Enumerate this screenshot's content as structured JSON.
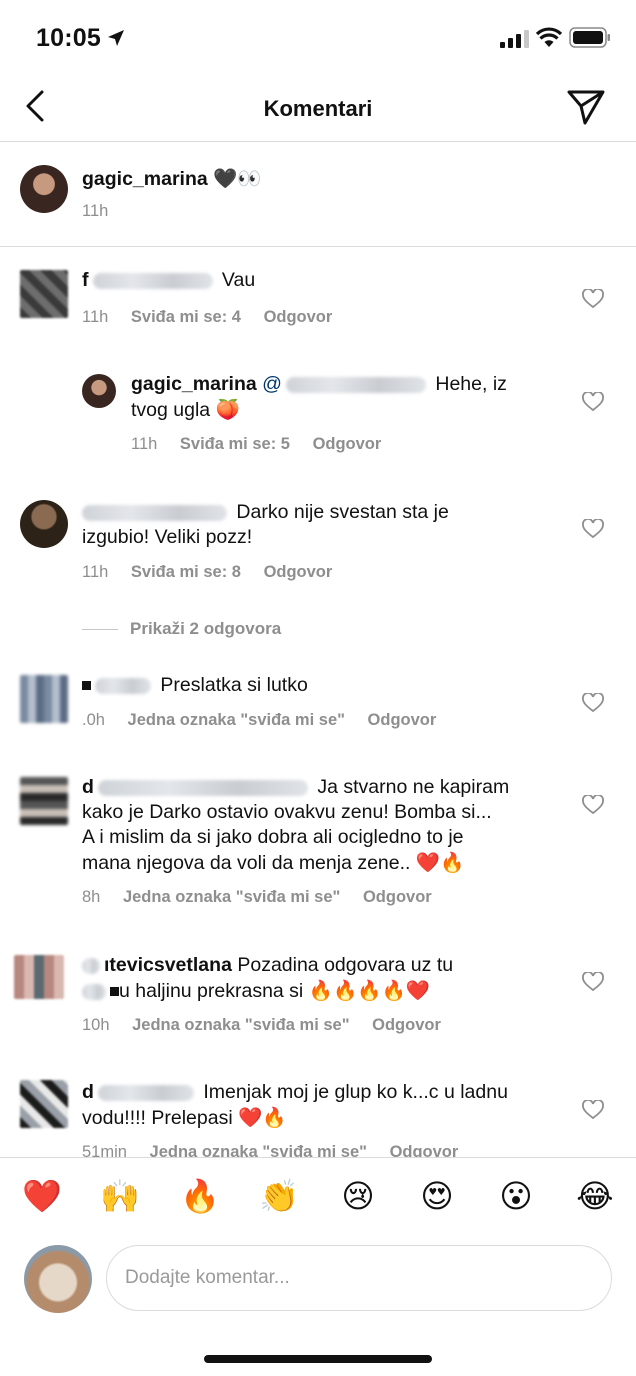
{
  "status_bar": {
    "time": "10:05"
  },
  "nav": {
    "title": "Komentari"
  },
  "caption": {
    "username": "gagic_marina",
    "emoji": "🖤👀",
    "time": "11h"
  },
  "comments": [
    {
      "name_prefix": "f",
      "text": "Vau",
      "time": "11h",
      "likes": "Sviđa mi se: 4",
      "reply": "Odgovor"
    },
    {
      "username": "gagic_marina",
      "mention": "@",
      "text_1": "Hehe, iz",
      "text_2": "tvog ugla",
      "emoji": "🍑",
      "time": "11h",
      "likes": "Sviđa mi se: 5",
      "reply": "Odgovor"
    },
    {
      "text_1": "Darko nije svestan sta je",
      "text_2": "izgubio! Veliki pozz!",
      "time": "11h",
      "likes": "Sviđa mi se: 8",
      "reply": "Odgovor",
      "show_replies": "Prikaži 2 odgovora"
    },
    {
      "text": "Preslatka si lutko",
      "time": ".0h",
      "likes": "Jedna oznaka \"sviđa mi se\"",
      "reply": "Odgovor"
    },
    {
      "name_prefix": "d",
      "text_1": "Ja stvarno ne kapiram",
      "text_2": "kako je Darko ostavio ovakvu zenu! Bomba si...",
      "text_3": "A i mislim da si jako dobra ali ocigledno to je",
      "text_4": "mana njegova da voli da menja zene..",
      "emoji": "❤️🔥",
      "time": "8h",
      "likes": "Jedna oznaka \"sviđa mi se\"",
      "reply": "Odgovor"
    },
    {
      "name_suffix": "ıtevicsvetlana",
      "text_1": "Pozadina odgovara uz tu",
      "text_2": "u haljinu prekrasna si",
      "emoji": "🔥🔥🔥🔥❤️",
      "time": "10h",
      "likes": "Jedna oznaka \"sviđa mi se\"",
      "reply": "Odgovor"
    },
    {
      "name_prefix": "d",
      "text_1": "Imenjak moj je glup ko k...c u ladnu",
      "text_2": "vodu!!!! Prelepasi",
      "emoji": "❤️🔥",
      "time": "51min",
      "likes": "Jedna oznaka \"sviđa mi se\"",
      "reply": "Odgovor"
    }
  ],
  "reactions": [
    "❤️",
    "🙌",
    "🔥",
    "👏",
    "😢",
    "😍",
    "😮",
    "😂"
  ],
  "composer": {
    "placeholder": "Dodajte komentar..."
  },
  "colors": {
    "secondary_text": "#8e8e8e",
    "divider": "#dbdbdb"
  }
}
